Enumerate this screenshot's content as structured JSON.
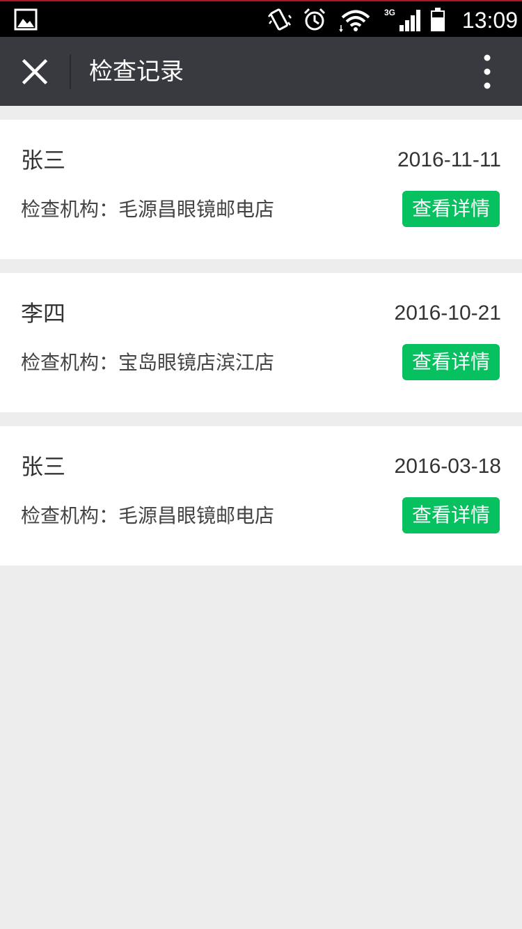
{
  "status_bar": {
    "time": "13:09",
    "network_type": "3G",
    "icons": [
      "gallery-icon",
      "vibrate-icon",
      "alarm-icon",
      "wifi-icon",
      "signal-icon",
      "battery-icon"
    ]
  },
  "header": {
    "title": "检查记录",
    "close_icon": "close-icon",
    "more_icon": "more-vertical-icon"
  },
  "colors": {
    "status_bar_bg": "#000000",
    "header_bg": "#393a3f",
    "page_bg": "#ededed",
    "card_bg": "#ffffff",
    "accent_green": "#07c160"
  },
  "records": [
    {
      "name": "张三",
      "date": "2016-11-11",
      "org_label": "检查机构：",
      "org_name": "毛源昌眼镜邮电店",
      "detail_label": "查看详情"
    },
    {
      "name": "李四",
      "date": "2016-10-21",
      "org_label": "检查机构：",
      "org_name": "宝岛眼镜店滨江店",
      "detail_label": "查看详情"
    },
    {
      "name": "张三",
      "date": "2016-03-18",
      "org_label": "检查机构：",
      "org_name": "毛源昌眼镜邮电店",
      "detail_label": "查看详情"
    }
  ]
}
